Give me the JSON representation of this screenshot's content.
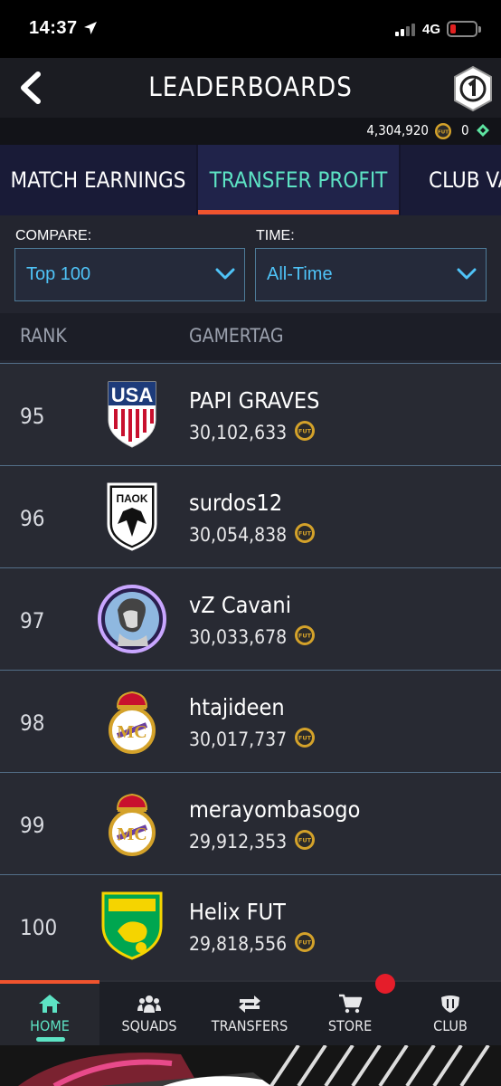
{
  "status_bar": {
    "time": "14:37",
    "network": "4G"
  },
  "header": {
    "title": "LEADERBOARDS"
  },
  "currency": {
    "coins": "4,304,920",
    "coin_label": "FUT",
    "points": "0"
  },
  "tabs": [
    {
      "label": "MATCH EARNINGS",
      "active": false
    },
    {
      "label": "TRANSFER PROFIT",
      "active": true
    },
    {
      "label": "CLUB VAL",
      "active": false
    }
  ],
  "filters": {
    "compare": {
      "label": "COMPARE:",
      "value": "Top 100"
    },
    "time": {
      "label": "TIME:",
      "value": "All-Time"
    }
  },
  "columns": {
    "rank": "RANK",
    "gamertag": "GAMERTAG"
  },
  "rows": [
    {
      "rank": "95",
      "name": "PAPI GRAVES",
      "value": "30,102,633",
      "crest": "usa-crest-icon"
    },
    {
      "rank": "96",
      "name": "surdos12",
      "value": "30,054,838",
      "crest": "paok-crest-icon"
    },
    {
      "rank": "97",
      "name": "vZ Cavani",
      "value": "30,033,678",
      "crest": "statue-avatar-icon"
    },
    {
      "rank": "98",
      "name": "htajideen",
      "value": "30,017,737",
      "crest": "real-madrid-crest-icon"
    },
    {
      "rank": "99",
      "name": "merayombasogo",
      "value": "29,912,353",
      "crest": "real-madrid-crest-icon"
    },
    {
      "rank": "100",
      "name": "Helix FUT",
      "value": "29,818,556",
      "crest": "norwich-crest-icon"
    }
  ],
  "nav": [
    {
      "label": "HOME",
      "icon": "home-icon",
      "active": true
    },
    {
      "label": "SQUADS",
      "icon": "squads-icon",
      "active": false
    },
    {
      "label": "TRANSFERS",
      "icon": "transfers-icon",
      "active": false
    },
    {
      "label": "STORE",
      "icon": "cart-icon",
      "active": false
    },
    {
      "label": "CLUB",
      "icon": "club-icon",
      "active": false
    }
  ],
  "colors": {
    "accent": "#5de3c4",
    "tab_indicator": "#f0542e",
    "dropdown_text": "#4fc3f7",
    "coin_gold": "#d4a22a"
  }
}
